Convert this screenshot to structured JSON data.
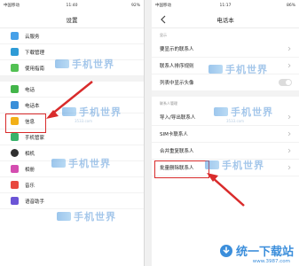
{
  "left": {
    "status": {
      "carrier": "中国移动",
      "time": "11:40",
      "battery": "92%"
    },
    "title": "设置",
    "items": [
      {
        "label": "云服务",
        "color": "#46a0e8"
      },
      {
        "label": "下载管理",
        "color": "#2e9bd6"
      },
      {
        "label": "使用指南",
        "color": "#52c153"
      },
      {
        "label": "电话",
        "color": "#43b54a"
      },
      {
        "label": "电话本",
        "color": "#3a8fd9"
      },
      {
        "label": "信息",
        "color": "#f2b018"
      },
      {
        "label": "手机管家",
        "color": "#38b36a"
      },
      {
        "label": "相机",
        "color": "#303030"
      },
      {
        "label": "相册",
        "color": "#d44db0"
      },
      {
        "label": "音乐",
        "color": "#e8483f"
      },
      {
        "label": "语音助手",
        "color": "#6b54d6"
      }
    ]
  },
  "right": {
    "status": {
      "carrier": "中国移动",
      "time": "11:17",
      "battery": "86%"
    },
    "title": "电话本",
    "section_display": "显示",
    "section_manage": "联系人管理",
    "items": [
      {
        "label": "要显示的联系人"
      },
      {
        "label": "联系人排序规则"
      },
      {
        "label": "列表中显示头像",
        "toggle": true
      },
      {
        "label": "导入/导出联系人"
      },
      {
        "label": "SIM卡联系人"
      },
      {
        "label": "合并重复联系人"
      },
      {
        "label": "批量删除联系人"
      }
    ]
  },
  "watermark": {
    "text": "手机世界",
    "sub": "3533.com"
  },
  "brand": {
    "name": "统一下载站",
    "url": "www.3987.com"
  },
  "colors": {
    "highlight": "#d92b2b",
    "accent": "#3b8edb"
  }
}
